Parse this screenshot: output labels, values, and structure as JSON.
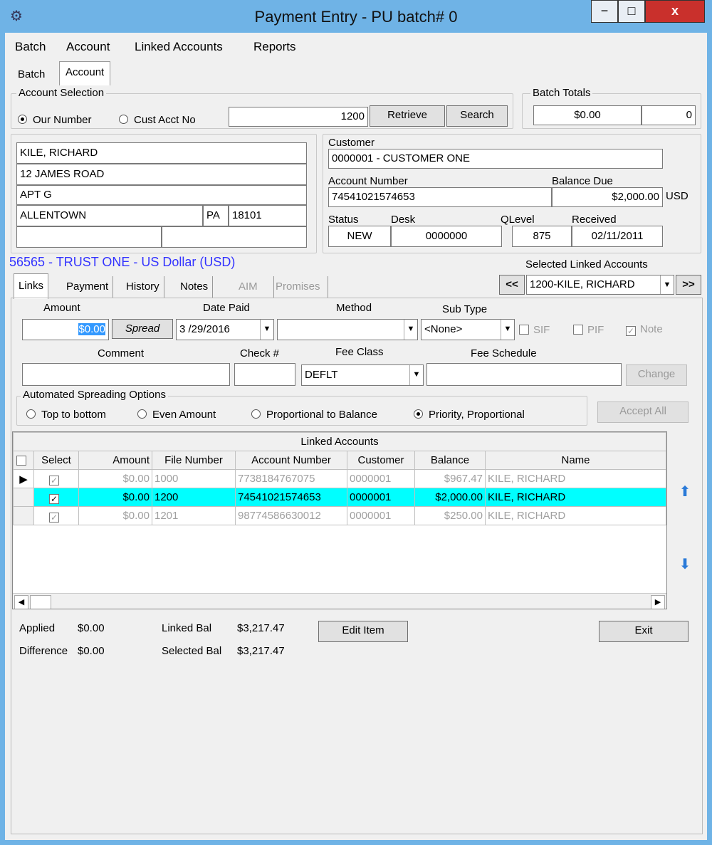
{
  "window": {
    "title": "Payment Entry - PU batch# 0",
    "controls": {
      "minimize": "−",
      "maximize": "□",
      "close": "x"
    }
  },
  "menu": [
    "Batch",
    "Account",
    "Linked Accounts",
    "Reports"
  ],
  "top_tabs": [
    "Batch",
    "Account"
  ],
  "account_selection": {
    "title": "Account Selection",
    "radio_our_number": "Our Number",
    "radio_cust_acct": "Cust Acct No",
    "value": "1200",
    "retrieve": "Retrieve",
    "search": "Search"
  },
  "batch_totals": {
    "title": "Batch Totals",
    "amount": "$0.00",
    "count": "0"
  },
  "address": {
    "name": "KILE, RICHARD",
    "line1": "12 JAMES ROAD",
    "line2": "APT G",
    "city": "ALLENTOWN",
    "state": "PA",
    "zip": "18101"
  },
  "customer": {
    "label": "Customer",
    "value": "0000001 - CUSTOMER ONE",
    "account_number_label": "Account Number",
    "account_number": "74541021574653",
    "balance_due_label": "Balance Due",
    "balance_due": "$2,000.00",
    "currency": "USD",
    "status_label": "Status",
    "status": "NEW",
    "desk_label": "Desk",
    "desk": "0000000",
    "qlevel_label": "QLevel",
    "qlevel": "875",
    "received_label": "Received",
    "received": "02/11/2011"
  },
  "trust_line": "56565 - TRUST ONE - US Dollar (USD)",
  "selected_linked": {
    "label": "Selected Linked Accounts",
    "prev": "<<",
    "next": ">>",
    "value": "1200-KILE, RICHARD"
  },
  "inner_tabs": [
    "Links",
    "Payment",
    "History",
    "Notes",
    "AIM",
    "Promises"
  ],
  "entry": {
    "amount_label": "Amount",
    "amount": "$0.00",
    "spread": "Spread",
    "date_label": "Date Paid",
    "date": "3 /29/2016",
    "method_label": "Method",
    "method": "",
    "subtype_label": "Sub Type",
    "subtype": "<None>",
    "sif": "SIF",
    "pif": "PIF",
    "note": "Note",
    "comment_label": "Comment",
    "comment": "",
    "check_label": "Check #",
    "check": "",
    "fee_class_label": "Fee Class",
    "fee_class": "DEFLT",
    "fee_schedule_label": "Fee Schedule",
    "fee_schedule": "",
    "change": "Change"
  },
  "spreading": {
    "title": "Automated Spreading Options",
    "options": [
      "Top to bottom",
      "Even Amount",
      "Proportional to Balance",
      "Priority, Proportional"
    ],
    "accept_all": "Accept All"
  },
  "linked_grid": {
    "title": "Linked Accounts",
    "columns": [
      "Select",
      "Amount",
      "File Number",
      "Account Number",
      "Customer",
      "Balance",
      "Name"
    ],
    "rows": [
      {
        "amount": "$0.00",
        "file": "1000",
        "account": "7738184767075",
        "customer": "0000001",
        "balance": "$967.47",
        "name": "KILE, RICHARD"
      },
      {
        "amount": "$0.00",
        "file": "1200",
        "account": "74541021574653",
        "customer": "0000001",
        "balance": "$2,000.00",
        "name": "KILE, RICHARD"
      },
      {
        "amount": "$0.00",
        "file": "1201",
        "account": "98774586630012",
        "customer": "0000001",
        "balance": "$250.00",
        "name": "KILE, RICHARD"
      }
    ]
  },
  "footer": {
    "applied_label": "Applied",
    "applied": "$0.00",
    "difference_label": "Difference",
    "difference": "$0.00",
    "linked_bal_label": "Linked Bal",
    "linked_bal": "$3,217.47",
    "selected_bal_label": "Selected Bal",
    "selected_bal": "$3,217.47",
    "edit_item": "Edit Item",
    "exit": "Exit"
  },
  "colors": {
    "selected_row": "#00ffff",
    "trust_text": "#3333ff",
    "titlebar": "#6fb3e6",
    "close": "#c9302c"
  }
}
